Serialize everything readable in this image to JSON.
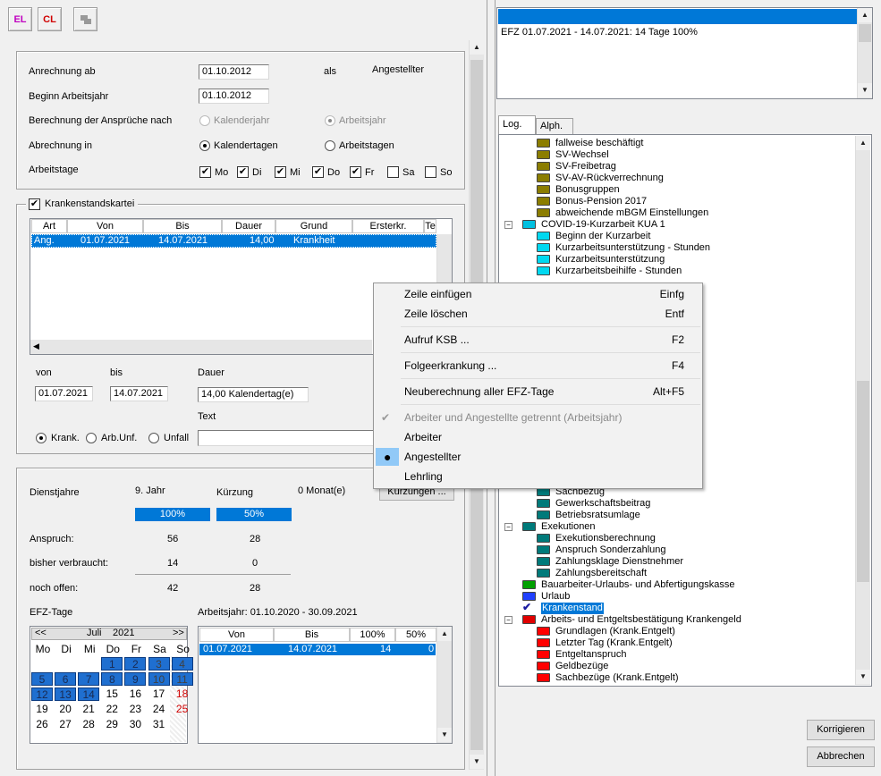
{
  "toolbar": {
    "el": "EL",
    "cl": "CL"
  },
  "settings": {
    "anrechnung_label": "Anrechnung ab",
    "anrechnung_value": "01.10.2012",
    "als_label": "als",
    "als_value": "Angestellter",
    "beginn_label": "Beginn Arbeitsjahr",
    "beginn_value": "01.10.2012",
    "berechnung_label": "Berechnung der Ansprüche nach",
    "opt_kalenderjahr": "Kalenderjahr",
    "opt_arbeitsjahr": "Arbeitsjahr",
    "abrechnung_label": "Abrechnung in",
    "opt_kalendertagen": "Kalendertagen",
    "opt_arbeitstagen": "Arbeitstagen",
    "arbeitstage_label": "Arbeitstage",
    "days": [
      "Mo",
      "Di",
      "Mi",
      "Do",
      "Fr",
      "Sa",
      "So"
    ]
  },
  "kartei": {
    "title": "Krankenstandskartei",
    "columns": [
      "Art",
      "Von",
      "Bis",
      "Dauer",
      "Grund",
      "Ersterkr.",
      "Te"
    ],
    "rows": [
      {
        "art": "Ang.",
        "von": "01.07.2021",
        "bis": "14.07.2021",
        "dauer": "14,00",
        "grund": "Krankheit"
      }
    ],
    "von_label": "von",
    "bis_label": "bis",
    "dauer_label": "Dauer",
    "von_value": "01.07.2021",
    "bis_value": "14.07.2021",
    "dauer_value": "14,00  Kalendertag(e)",
    "text_label": "Text",
    "opt_krank": "Krank.",
    "opt_arbunf": "Arb.Unf.",
    "opt_unfall": "Unfall"
  },
  "summary": {
    "dienstjahre_label": "Dienstjahre",
    "dienstjahre_value": "9. Jahr",
    "kuerzung_label": "Kürzung",
    "kuerzung_value": "0 Monat(e)",
    "kuerzungen_button": "Kürzungen ...",
    "pct1": "100%",
    "pct2": "50%",
    "anspruch_label": "Anspruch:",
    "anspruch_1": "56",
    "anspruch_2": "28",
    "verbraucht_label": "bisher verbraucht:",
    "verbraucht_1": "14",
    "verbraucht_2": "0",
    "offen_label": "noch offen:",
    "offen_1": "42",
    "offen_2": "28",
    "efz_label": "EFZ-Tage",
    "arbeitsjahr_label": "Arbeitsjahr: 01.10.2020 - 30.09.2021"
  },
  "calendar": {
    "prev": "<<",
    "month": "Juli",
    "year": "2021",
    "next": ">>",
    "weekdays": [
      "Mo",
      "Di",
      "Mi",
      "Do",
      "Fr",
      "Sa",
      "So"
    ],
    "weeks": [
      [
        "",
        "",
        "",
        "1",
        "2",
        "3",
        "4"
      ],
      [
        "5",
        "6",
        "7",
        "8",
        "9",
        "10",
        "11"
      ],
      [
        "12",
        "13",
        "14",
        "15",
        "16",
        "17",
        "18"
      ],
      [
        "19",
        "20",
        "21",
        "22",
        "23",
        "24",
        "25"
      ],
      [
        "26",
        "27",
        "28",
        "29",
        "30",
        "31",
        ""
      ]
    ],
    "highlight_max": 14,
    "red_days": [
      "18",
      "25"
    ]
  },
  "efz_table": {
    "columns": [
      "Von",
      "Bis",
      "100%",
      "50%"
    ],
    "row": {
      "von": "01.07.2021",
      "bis": "14.07.2021",
      "p100": "14",
      "p50": "0"
    }
  },
  "right": {
    "info_line": "EFZ 01.07.2021 - 14.07.2021: 14 Tage 100%",
    "tab_log": "Log.",
    "tab_alph": "Alph.",
    "tree_top": [
      {
        "label": "fallweise beschäftigt",
        "color": "#8b7d00",
        "indent": 2
      },
      {
        "label": "SV-Wechsel",
        "color": "#8b7d00",
        "indent": 2
      },
      {
        "label": "SV-Freibetrag",
        "color": "#8b7d00",
        "indent": 2
      },
      {
        "label": "SV-AV-Rückverrechnung",
        "color": "#8b7d00",
        "indent": 2
      },
      {
        "label": "Bonusgruppen",
        "color": "#8b7d00",
        "indent": 2
      },
      {
        "label": "Bonus-Pension 2017",
        "color": "#8b7d00",
        "indent": 2
      },
      {
        "label": "abweichende mBGM Einstellungen",
        "color": "#8b7d00",
        "indent": 2
      },
      {
        "label": "COVID-19-Kurzarbeit KUA 1",
        "color": "#00c0e0",
        "indent": 1,
        "open": true
      },
      {
        "label": "Beginn der Kurzarbeit",
        "color": "#00d8f0",
        "indent": 2
      },
      {
        "label": "Kurzarbeitsunterstützung - Stunden",
        "color": "#00d8f0",
        "indent": 2
      },
      {
        "label": "Kurzarbeitsunterstützung",
        "color": "#00d8f0",
        "indent": 2
      },
      {
        "label": "Kurzarbeitsbeihilfe - Stunden",
        "color": "#00d8f0",
        "indent": 2
      }
    ],
    "tree_bottom": [
      {
        "label": "Sachbezug",
        "color": "#007a7a",
        "indent": 2
      },
      {
        "label": "Gewerkschaftsbeitrag",
        "color": "#007a7a",
        "indent": 2
      },
      {
        "label": "Betriebsratsumlage",
        "color": "#007a7a",
        "indent": 2
      },
      {
        "label": "Exekutionen",
        "color": "#007a7a",
        "indent": 1,
        "open": true
      },
      {
        "label": "Exekutionsberechnung",
        "color": "#007a7a",
        "indent": 2
      },
      {
        "label": "Anspruch Sonderzahlung",
        "color": "#007a7a",
        "indent": 2
      },
      {
        "label": "Zahlungsklage Dienstnehmer",
        "color": "#007a7a",
        "indent": 2
      },
      {
        "label": "Zahlungsbereitschaft",
        "color": "#007a7a",
        "indent": 2
      },
      {
        "label": "Bauarbeiter-Urlaubs- und Abfertigungskasse",
        "color": "#00a000",
        "indent": 1
      },
      {
        "label": "Urlaub",
        "color": "#2040ff",
        "indent": 1
      },
      {
        "label": "Krankenstand",
        "color": "check",
        "indent": 1,
        "selected": true
      },
      {
        "label": "Arbeits- und Entgeltsbestätigung Krankengeld",
        "color": "#e00000",
        "indent": 1,
        "open": true
      },
      {
        "label": "Grundlagen (Krank.Entgelt)",
        "color": "#ff0000",
        "indent": 2
      },
      {
        "label": "Letzter Tag (Krank.Entgelt)",
        "color": "#ff0000",
        "indent": 2
      },
      {
        "label": "Entgeltanspruch",
        "color": "#ff0000",
        "indent": 2
      },
      {
        "label": "Geldbezüge",
        "color": "#ff0000",
        "indent": 2
      },
      {
        "label": "Sachbezüge (Krank.Entgelt)",
        "color": "#ff0000",
        "indent": 2
      }
    ],
    "korrigieren": "Korrigieren",
    "abbrechen": "Abbrechen"
  },
  "context_menu": [
    {
      "label": "Zeile einfügen",
      "shortcut": "Einfg"
    },
    {
      "label": "Zeile löschen",
      "shortcut": "Entf"
    },
    {
      "sep": true
    },
    {
      "label": "Aufruf KSB ...",
      "shortcut": "F2"
    },
    {
      "sep": true
    },
    {
      "label": "Folgeerkrankung ...",
      "shortcut": "F4"
    },
    {
      "sep": true
    },
    {
      "label": "Neuberechnung aller EFZ-Tage",
      "shortcut": "Alt+F5"
    },
    {
      "sep": true
    },
    {
      "label": "Arbeiter und Angestellte getrennt (Arbeitsjahr)",
      "disabled": true,
      "mark": "check"
    },
    {
      "label": "Arbeiter"
    },
    {
      "label": "Angestellter",
      "mark": "dot",
      "highlight": true
    },
    {
      "label": "Lehrling"
    }
  ]
}
